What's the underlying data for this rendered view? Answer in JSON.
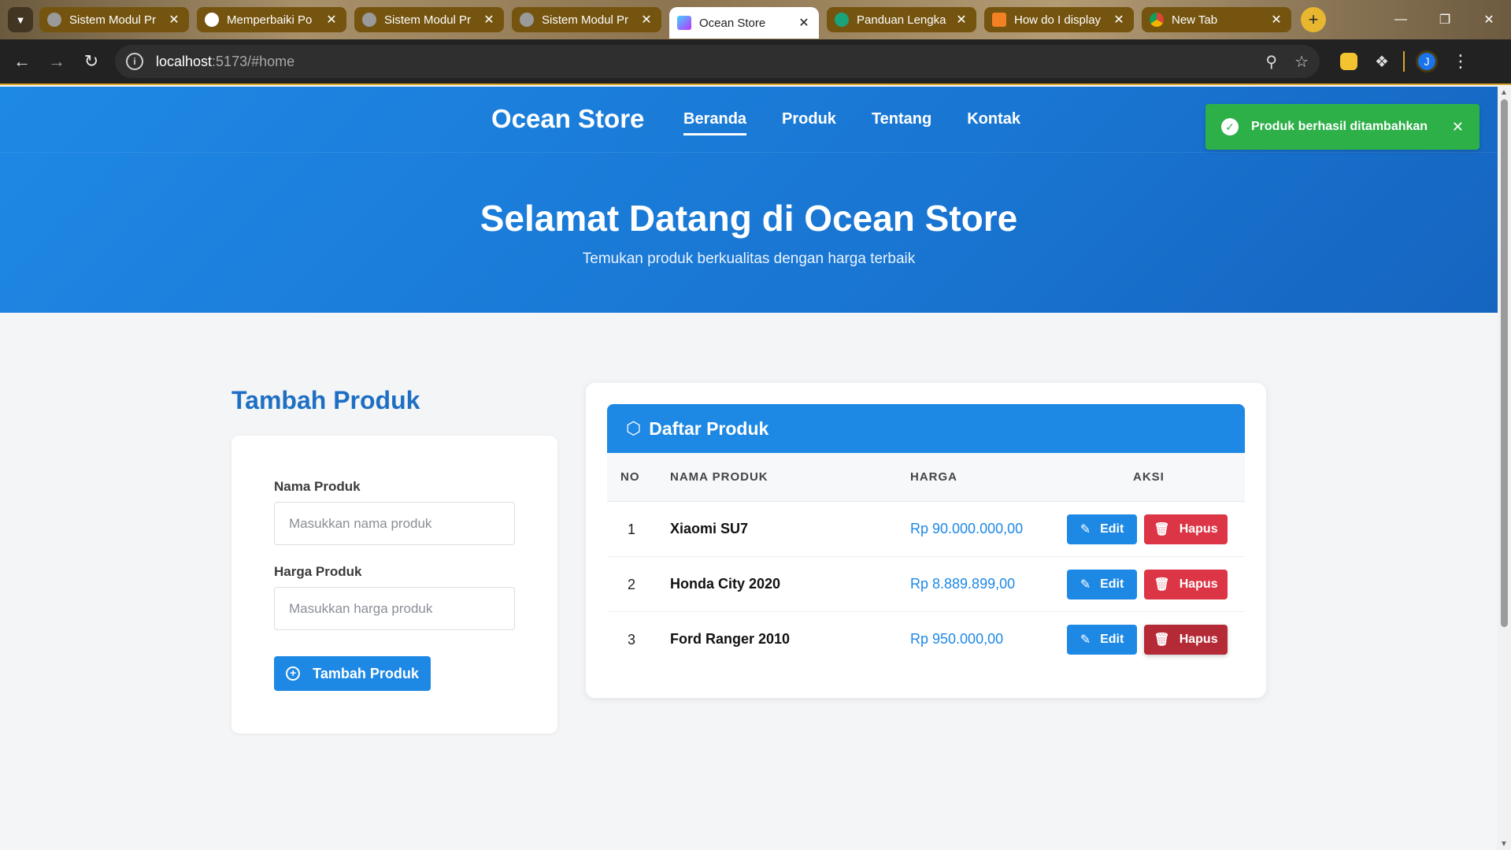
{
  "browser": {
    "tabs": [
      {
        "title": "Sistem Modul Pr",
        "favicon_color": "#9a9a9a"
      },
      {
        "title": "Memperbaiki Po",
        "favicon_color": "#ffffff"
      },
      {
        "title": "Sistem Modul Pr",
        "favicon_color": "#9a9a9a"
      },
      {
        "title": "Sistem Modul Pr",
        "favicon_color": "#9a9a9a"
      },
      {
        "title": "Ocean Store",
        "favicon_color": "#8e5cf7",
        "active": true
      },
      {
        "title": "Panduan Lengka",
        "favicon_color": "#1aa37a"
      },
      {
        "title": "How do I display",
        "favicon_color": "#f48024"
      },
      {
        "title": "New Tab",
        "favicon_color": "#ffffff"
      }
    ],
    "url_host": "localhost",
    "url_path": ":5173/#home",
    "avatar_letter": "J"
  },
  "site": {
    "brand": "Ocean Store",
    "nav": [
      "Beranda",
      "Produk",
      "Tentang",
      "Kontak"
    ],
    "hero_title": "Selamat Datang di Ocean Store",
    "hero_subtitle": "Temukan produk berkualitas dengan harga terbaik"
  },
  "toast": {
    "message": "Produk berhasil ditambahkan",
    "color": "#2eb049"
  },
  "form": {
    "title": "Tambah Produk",
    "name_label": "Nama Produk",
    "name_placeholder": "Masukkan nama produk",
    "price_label": "Harga Produk",
    "price_placeholder": "Masukkan harga produk",
    "submit_label": "Tambah Produk"
  },
  "list": {
    "title": "Daftar Produk",
    "columns": [
      "NO",
      "NAMA PRODUK",
      "HARGA",
      "AKSI"
    ],
    "edit_label": "Edit",
    "delete_label": "Hapus",
    "rows": [
      {
        "no": "1",
        "name": "Xiaomi SU7",
        "price": "Rp 90.000.000,00"
      },
      {
        "no": "2",
        "name": "Honda City 2020",
        "price": "Rp 8.889.899,00"
      },
      {
        "no": "3",
        "name": "Ford Ranger 2010",
        "price": "Rp 950.000,00"
      }
    ]
  },
  "colors": {
    "primary": "#1e88e5",
    "danger": "#dc3545",
    "success": "#2eb049"
  }
}
